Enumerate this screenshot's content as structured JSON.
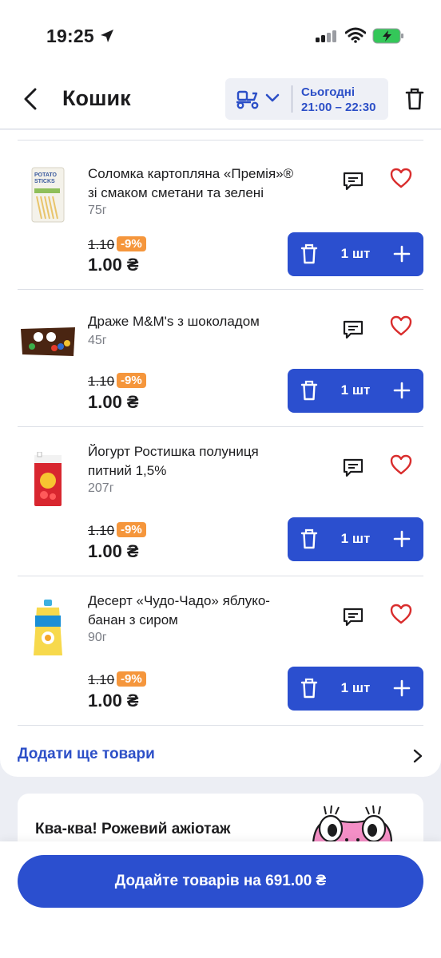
{
  "status_bar": {
    "time": "19:25"
  },
  "header": {
    "title": "Кошик",
    "delivery_day": "Сьогодні",
    "delivery_time": "21:00 – 22:30"
  },
  "cart": {
    "items": [
      {
        "name_line1": "Соломка картопляна «Премія»®",
        "name_line2": "зі смаком сметани та зелені",
        "weight": "75г",
        "old_price": "1.10",
        "discount": "-9%",
        "price": "1.00 ₴",
        "quantity": "1 шт"
      },
      {
        "name_line1": "Драже M&M's з шоколадом",
        "name_line2": "",
        "weight": "45г",
        "old_price": "1.10",
        "discount": "-9%",
        "price": "1.00 ₴",
        "quantity": "1 шт"
      },
      {
        "name_line1": "Йогурт Ростишка полуниця",
        "name_line2": "питний 1,5%",
        "weight": "207г",
        "old_price": "1.10",
        "discount": "-9%",
        "price": "1.00 ₴",
        "quantity": "1 шт"
      },
      {
        "name_line1": "Десерт «Чудо-Чадо» яблуко-",
        "name_line2": "банан з сиром",
        "weight": "90г",
        "old_price": "1.10",
        "discount": "-9%",
        "price": "1.00 ₴",
        "quantity": "1 шт"
      }
    ],
    "add_more_label": "Додати ще товари"
  },
  "promo": {
    "text": "Ква-ква! Рожевий ажіотаж"
  },
  "checkout": {
    "button_label": "Додайте товарів на 691.00 ₴"
  },
  "colors": {
    "accent": "#2b4fcf",
    "link": "#2c4fc7",
    "discount": "#f5963c",
    "heart": "#d92d2d"
  },
  "icons": [
    "location-arrow-icon",
    "signal-icon",
    "wifi-icon",
    "battery-charging-icon",
    "back-chevron-icon",
    "scooter-icon",
    "chevron-down-icon",
    "trash-icon",
    "comment-icon",
    "heart-icon",
    "plus-icon",
    "chevron-right-icon"
  ]
}
